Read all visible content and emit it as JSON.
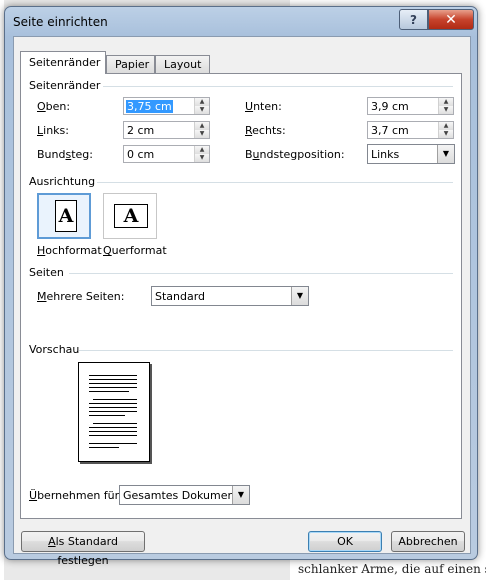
{
  "dialog": {
    "title": "Seite einrichten",
    "help_glyph": "?",
    "close_glyph": "✕"
  },
  "tabs": [
    {
      "label": "Seitenränder",
      "active": true
    },
    {
      "label": "Papier",
      "active": false
    },
    {
      "label": "Layout",
      "active": false
    }
  ],
  "margins": {
    "group_label": "Seitenränder",
    "oben": {
      "label": "Oben:",
      "value": "3,75 cm"
    },
    "unten": {
      "label": "Unten:",
      "value": "3,9 cm"
    },
    "links": {
      "label": "Links:",
      "value": "2 cm"
    },
    "rechts": {
      "label": "Rechts:",
      "value": "3,7 cm"
    },
    "bundsteg": {
      "label": "Bundsteg:",
      "value": "0 cm"
    },
    "bundstegposition": {
      "label": "Bundstegposition:",
      "value": "Links"
    }
  },
  "orientation": {
    "group_label": "Ausrichtung",
    "portrait": {
      "label": "Hochformat",
      "glyph": "A"
    },
    "landscape": {
      "label": "Querformat",
      "glyph": "A"
    }
  },
  "pages": {
    "group_label": "Seiten",
    "mehrere_label": "Mehrere Seiten:",
    "mehrere_value": "Standard"
  },
  "preview": {
    "group_label": "Vorschau"
  },
  "apply": {
    "label": "Übernehmen für:",
    "value": "Gesamtes Dokument"
  },
  "buttons": {
    "default": "Als Standard festlegen",
    "ok": "OK",
    "cancel": "Abbrechen"
  },
  "background": {
    "bottom_text": "schlanker Arme, die auf einen sta"
  }
}
